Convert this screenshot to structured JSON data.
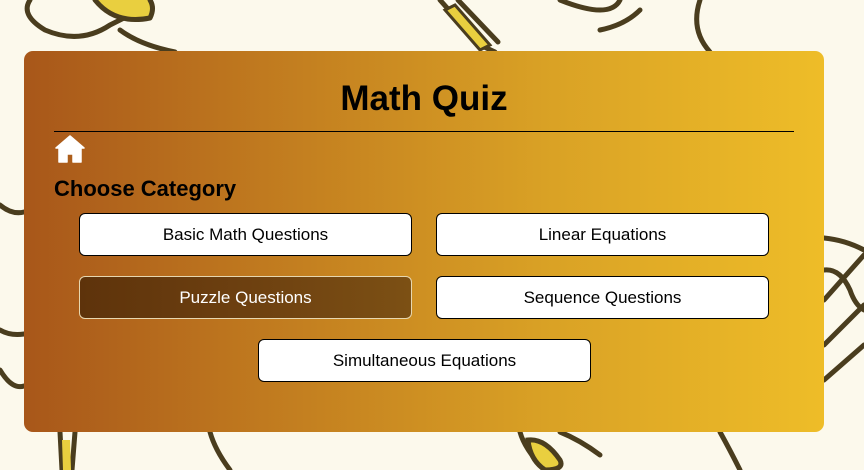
{
  "quiz": {
    "title": "Math Quiz",
    "home_icon": "home-icon",
    "section_heading": "Choose Category",
    "categories": [
      {
        "label": "Basic Math Questions",
        "selected": false
      },
      {
        "label": "Linear Equations",
        "selected": false
      },
      {
        "label": "Puzzle Questions",
        "selected": true
      },
      {
        "label": "Sequence Questions",
        "selected": false
      },
      {
        "label": "Simultaneous Equations",
        "selected": false
      }
    ]
  },
  "colors": {
    "page_background": "#fcf9ec",
    "card_gradient_start": "#a8571a",
    "card_gradient_end": "#eebd28",
    "selected_button": "#6d4010",
    "decor_stroke": "#4a3d1e",
    "decor_fill": "#e9cf3f"
  }
}
